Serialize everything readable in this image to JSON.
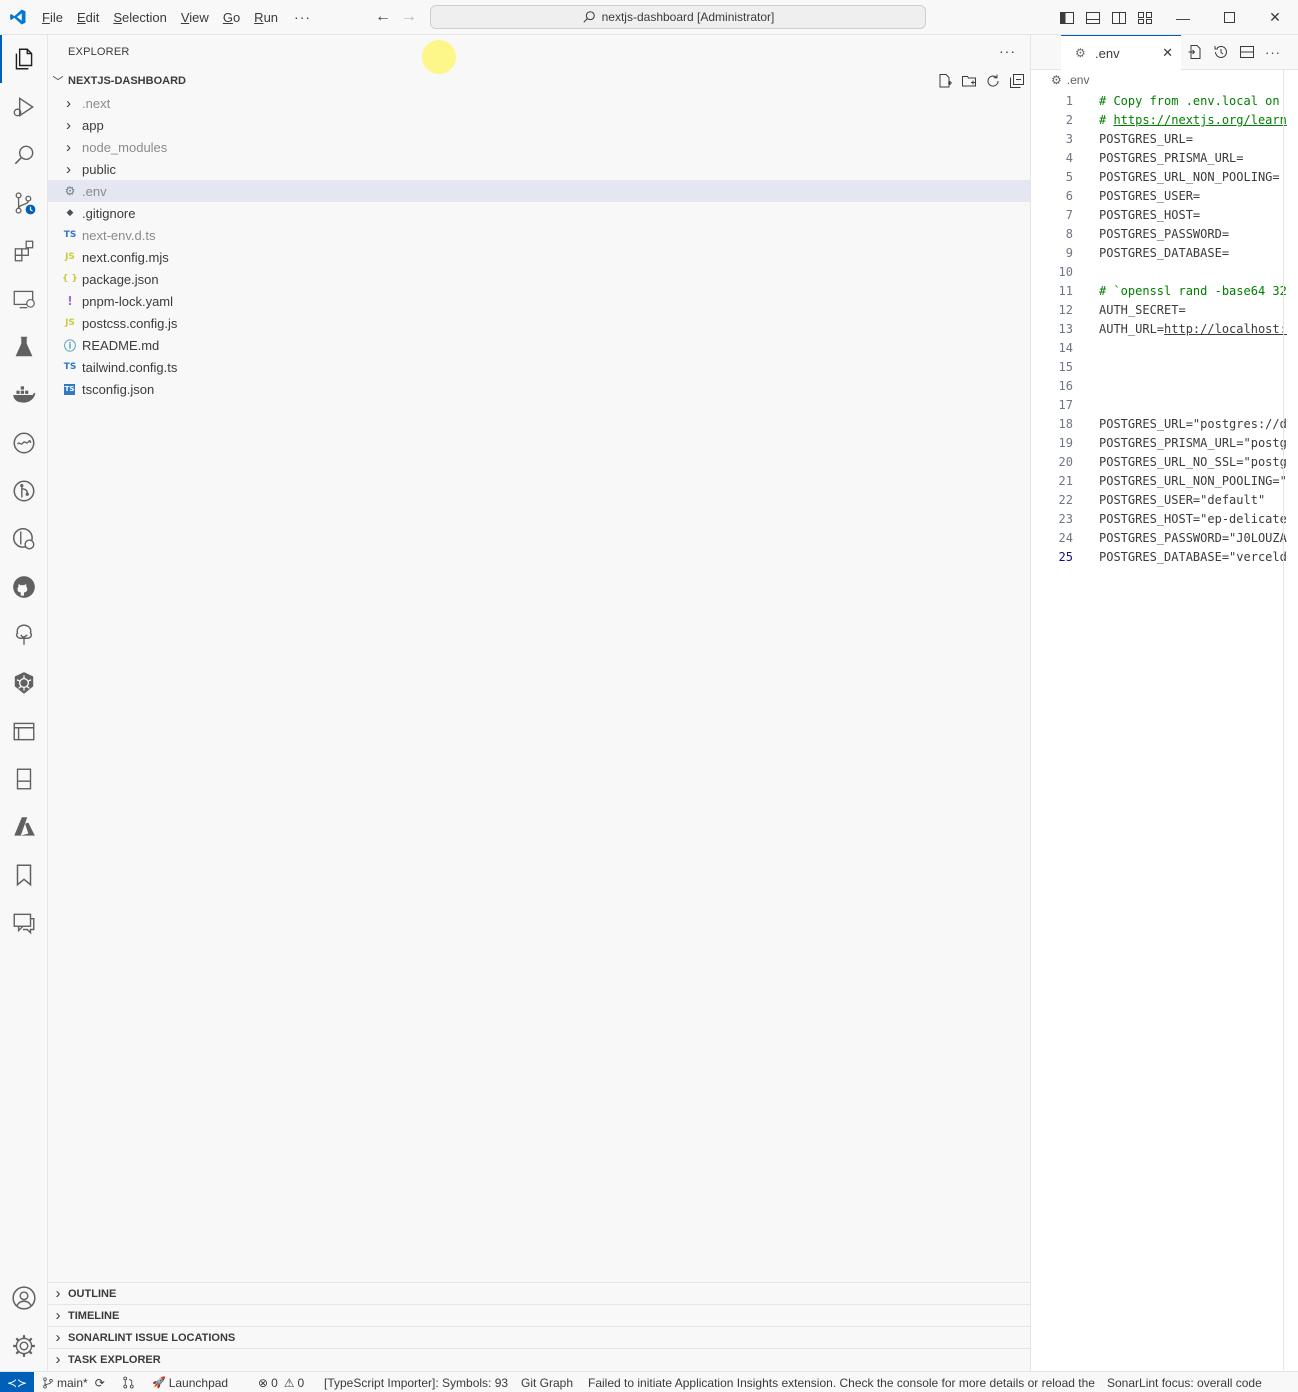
{
  "window": {
    "title": "nextjs-dashboard [Administrator]",
    "menu": [
      {
        "label": "File",
        "accel": "F",
        "rest": "ile"
      },
      {
        "label": "Edit",
        "accel": "E",
        "rest": "dit"
      },
      {
        "label": "Selection",
        "accel": "S",
        "rest": "election"
      },
      {
        "label": "View",
        "accel": "V",
        "rest": "iew"
      },
      {
        "label": "Go",
        "accel": "G",
        "rest": "o"
      },
      {
        "label": "Run",
        "accel": "R",
        "rest": "un"
      }
    ],
    "menu_more": "···"
  },
  "activity_bar": {
    "items": [
      "explorer-icon",
      "run-debug-icon",
      "search-icon",
      "source-control-icon",
      "extensions-icon",
      "remote-explorer-icon",
      "testing-flask-icon",
      "docker-icon",
      "wave-icon",
      "git-graph-icon",
      "gitlens-icon",
      "github-icon",
      "tree-icon",
      "kubernetes-icon",
      "panels-icon",
      "book-icon",
      "azure-icon",
      "bookmark-icon",
      "comments-icon"
    ],
    "bottom": [
      "account-icon",
      "manage-gear-icon"
    ]
  },
  "explorer": {
    "header": "EXPLORER",
    "more": "···",
    "folder": "NEXTJS-DASHBOARD",
    "items": [
      {
        "name": ".next",
        "type": "folder",
        "dim": true
      },
      {
        "name": "app",
        "type": "folder",
        "dim": false
      },
      {
        "name": "node_modules",
        "type": "folder",
        "dim": true
      },
      {
        "name": "public",
        "type": "folder",
        "dim": false
      },
      {
        "name": ".env",
        "type": "env",
        "dim": true,
        "selected": true
      },
      {
        "name": ".gitignore",
        "type": "git",
        "dim": false
      },
      {
        "name": "next-env.d.ts",
        "type": "ts",
        "dim": true
      },
      {
        "name": "next.config.mjs",
        "type": "js",
        "dim": false
      },
      {
        "name": "package.json",
        "type": "json",
        "dim": false
      },
      {
        "name": "pnpm-lock.yaml",
        "type": "yaml",
        "dim": false
      },
      {
        "name": "postcss.config.js",
        "type": "js",
        "dim": false
      },
      {
        "name": "README.md",
        "type": "info",
        "dim": false
      },
      {
        "name": "tailwind.config.ts",
        "type": "ts",
        "dim": false
      },
      {
        "name": "tsconfig.json",
        "type": "tsconfig",
        "dim": false
      }
    ],
    "icon_glyphs": {
      "ts": "TS",
      "js": "JS",
      "json": "{ }",
      "yaml": "!",
      "info": "ⓘ",
      "git": "◆",
      "env": "⚙",
      "tsconfig": "TS"
    },
    "sections": [
      "OUTLINE",
      "TIMELINE",
      "SONARLINT ISSUE LOCATIONS",
      "TASK EXPLORER"
    ]
  },
  "editor": {
    "tab_label": ".env",
    "breadcrumb": ".env",
    "current_line": 25,
    "lines": [
      {
        "n": "1",
        "t": "# Copy from .env.local on",
        "kind": "comment"
      },
      {
        "n": "2",
        "t": "# https://nextjs.org/learn",
        "kind": "link"
      },
      {
        "n": "3",
        "t": "POSTGRES_URL=",
        "kind": "plain"
      },
      {
        "n": "4",
        "t": "POSTGRES_PRISMA_URL=",
        "kind": "plain"
      },
      {
        "n": "5",
        "t": "POSTGRES_URL_NON_POOLING=",
        "kind": "plain"
      },
      {
        "n": "6",
        "t": "POSTGRES_USER=",
        "kind": "plain"
      },
      {
        "n": "7",
        "t": "POSTGRES_HOST=",
        "kind": "plain"
      },
      {
        "n": "8",
        "t": "POSTGRES_PASSWORD=",
        "kind": "plain"
      },
      {
        "n": "9",
        "t": "POSTGRES_DATABASE=",
        "kind": "plain"
      },
      {
        "n": "10",
        "t": "",
        "kind": "plain"
      },
      {
        "n": "11",
        "t": "# `openssl rand -base64 32",
        "kind": "comment"
      },
      {
        "n": "12",
        "t": "AUTH_SECRET=",
        "kind": "plain"
      },
      {
        "n": "13",
        "t": "AUTH_URL=http://localhost:",
        "kind": "url"
      },
      {
        "n": "14",
        "t": "",
        "kind": "plain"
      },
      {
        "n": "15",
        "t": "",
        "kind": "plain"
      },
      {
        "n": "16",
        "t": "",
        "kind": "plain"
      },
      {
        "n": "17",
        "t": "",
        "kind": "plain"
      },
      {
        "n": "18",
        "t": "POSTGRES_URL=\"postgres://d",
        "kind": "plain"
      },
      {
        "n": "19",
        "t": "POSTGRES_PRISMA_URL=\"postg",
        "kind": "plain"
      },
      {
        "n": "20",
        "t": "POSTGRES_URL_NO_SSL=\"postg",
        "kind": "plain"
      },
      {
        "n": "21",
        "t": "POSTGRES_URL_NON_POOLING=\"",
        "kind": "plain"
      },
      {
        "n": "22",
        "t": "POSTGRES_USER=\"default\"",
        "kind": "plain"
      },
      {
        "n": "23",
        "t": "POSTGRES_HOST=\"ep-delicate",
        "kind": "plain"
      },
      {
        "n": "24",
        "t": "POSTGRES_PASSWORD=\"J0LOUZA",
        "kind": "plain"
      },
      {
        "n": "25",
        "t": "POSTGRES_DATABASE=\"verceld",
        "kind": "plain"
      }
    ]
  },
  "statusbar": {
    "branch": "main*",
    "launchpad": "Launchpad",
    "errors": "0",
    "warnings": "0",
    "ts_importer": "[TypeScript Importer]: Symbols: 93",
    "git_graph": "Git Graph",
    "message": "Failed to initiate Application Insights extension. Check the console for more details or reload the",
    "sonarlint": "SonarLint focus: overall code"
  },
  "colors": {
    "accent": "#005fb8",
    "selection": "#e4e6f1",
    "comment": "#008000"
  }
}
